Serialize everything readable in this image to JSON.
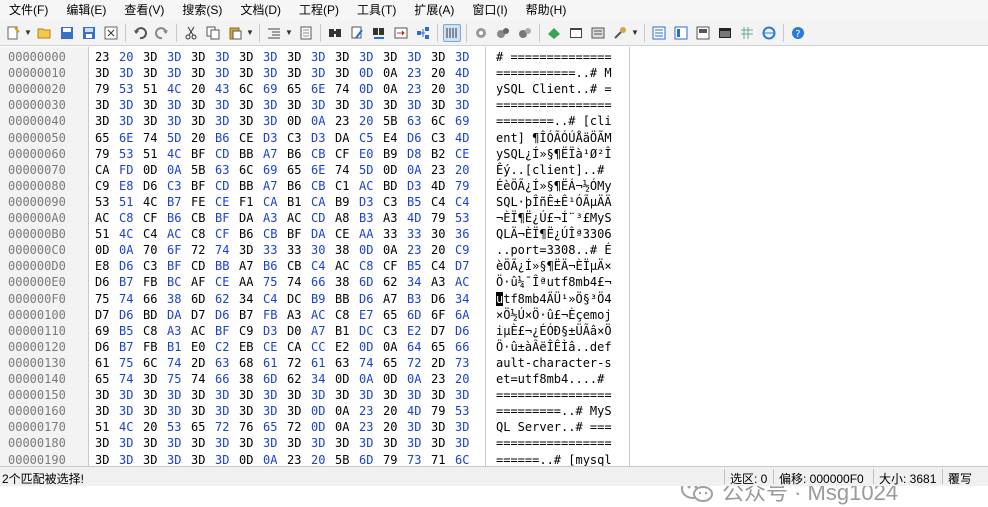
{
  "menu": [
    "文件(F)",
    "编辑(E)",
    "查看(V)",
    "搜索(S)",
    "文档(D)",
    "工程(P)",
    "工具(T)",
    "扩展(A)",
    "窗口(I)",
    "帮助(H)"
  ],
  "toolbar_icons": [
    "new-file-icon",
    "open-folder-icon",
    "save-icon",
    "save-all-icon",
    "close-file-icon",
    "undo-icon",
    "redo-icon",
    "cut-icon",
    "copy-icon",
    "paste-icon",
    "insert-icon",
    "document-icon",
    "find-icon",
    "find-next-icon",
    "find-in-files-icon",
    "goto-icon",
    "structure-icon",
    "hex-mode-icon",
    "settings-icon",
    "wrench-icon",
    "browser-icon",
    "help-icon"
  ],
  "rows": [
    {
      "addr": "00000000",
      "hex": [
        "23",
        "20",
        "3D",
        "3D",
        "3D",
        "3D",
        "3D",
        "3D",
        "3D",
        "3D",
        "3D",
        "3D",
        "3D",
        "3D",
        "3D",
        "3D"
      ],
      "ascii": "# =============="
    },
    {
      "addr": "00000010",
      "hex": [
        "3D",
        "3D",
        "3D",
        "3D",
        "3D",
        "3D",
        "3D",
        "3D",
        "3D",
        "3D",
        "3D",
        "0D",
        "0A",
        "23",
        "20",
        "4D"
      ],
      "ascii": "===========..# M"
    },
    {
      "addr": "00000020",
      "hex": [
        "79",
        "53",
        "51",
        "4C",
        "20",
        "43",
        "6C",
        "69",
        "65",
        "6E",
        "74",
        "0D",
        "0A",
        "23",
        "20",
        "3D"
      ],
      "ascii": "ySQL Client..# ="
    },
    {
      "addr": "00000030",
      "hex": [
        "3D",
        "3D",
        "3D",
        "3D",
        "3D",
        "3D",
        "3D",
        "3D",
        "3D",
        "3D",
        "3D",
        "3D",
        "3D",
        "3D",
        "3D",
        "3D"
      ],
      "ascii": "================"
    },
    {
      "addr": "00000040",
      "hex": [
        "3D",
        "3D",
        "3D",
        "3D",
        "3D",
        "3D",
        "3D",
        "3D",
        "0D",
        "0A",
        "23",
        "20",
        "5B",
        "63",
        "6C",
        "69"
      ],
      "ascii": "========..# [cli"
    },
    {
      "addr": "00000050",
      "hex": [
        "65",
        "6E",
        "74",
        "5D",
        "20",
        "B6",
        "CE",
        "D3",
        "C3",
        "D3",
        "DA",
        "C5",
        "E4",
        "D6",
        "C3",
        "4D"
      ],
      "ascii": "ent] ¶ÎÓÃÓÚÅäÖÃM"
    },
    {
      "addr": "00000060",
      "hex": [
        "79",
        "53",
        "51",
        "4C",
        "BF",
        "CD",
        "BB",
        "A7",
        "B6",
        "CB",
        "CF",
        "E0",
        "B9",
        "D8",
        "B2",
        "CE"
      ],
      "ascii": "ySQL¿Í»§¶ËÏà¹Ø²Î"
    },
    {
      "addr": "00000070",
      "hex": [
        "CA",
        "FD",
        "0D",
        "0A",
        "5B",
        "63",
        "6C",
        "69",
        "65",
        "6E",
        "74",
        "5D",
        "0D",
        "0A",
        "23",
        "20"
      ],
      "ascii": "Êý..[client]..# "
    },
    {
      "addr": "00000080",
      "hex": [
        "C9",
        "E8",
        "D6",
        "C3",
        "BF",
        "CD",
        "BB",
        "A7",
        "B6",
        "CB",
        "C1",
        "AC",
        "BD",
        "D3",
        "4D",
        "79"
      ],
      "ascii": "ÉèÖÃ¿Í»§¶ËÁ¬½ÓMy"
    },
    {
      "addr": "00000090",
      "hex": [
        "53",
        "51",
        "4C",
        "B7",
        "FE",
        "CE",
        "F1",
        "CA",
        "B1",
        "CA",
        "B9",
        "D3",
        "C3",
        "B5",
        "C4",
        "C4"
      ],
      "ascii": "SQL·þÎñÊ±Ê¹ÓÃµÄÄ"
    },
    {
      "addr": "000000A0",
      "hex": [
        "AC",
        "C8",
        "CF",
        "B6",
        "CB",
        "BF",
        "DA",
        "A3",
        "AC",
        "CD",
        "A8",
        "B3",
        "A3",
        "4D",
        "79",
        "53"
      ],
      "ascii": "¬ÈÏ¶Ë¿Ú£¬Í¨³£MyS"
    },
    {
      "addr": "000000B0",
      "hex": [
        "51",
        "4C",
        "C4",
        "AC",
        "C8",
        "CF",
        "B6",
        "CB",
        "BF",
        "DA",
        "CE",
        "AA",
        "33",
        "33",
        "30",
        "36"
      ],
      "ascii": "QLÄ¬ÈÏ¶Ë¿ÚÎª3306"
    },
    {
      "addr": "000000C0",
      "hex": [
        "0D",
        "0A",
        "70",
        "6F",
        "72",
        "74",
        "3D",
        "33",
        "33",
        "30",
        "38",
        "0D",
        "0A",
        "23",
        "20",
        "C9"
      ],
      "ascii": "..port=3308..# É"
    },
    {
      "addr": "000000D0",
      "hex": [
        "E8",
        "D6",
        "C3",
        "BF",
        "CD",
        "BB",
        "A7",
        "B6",
        "CB",
        "C4",
        "AC",
        "C8",
        "CF",
        "B5",
        "C4",
        "D7"
      ],
      "ascii": "èÖÃ¿Í»§¶ËÄ¬ÈÏµÄ×"
    },
    {
      "addr": "000000E0",
      "hex": [
        "D6",
        "B7",
        "FB",
        "BC",
        "AF",
        "CE",
        "AA",
        "75",
        "74",
        "66",
        "38",
        "6D",
        "62",
        "34",
        "A3",
        "AC"
      ],
      "ascii": "Ö·û¼¯Îªutf8mb4£¬"
    },
    {
      "addr": "000000F0",
      "hex": [
        "75",
        "74",
        "66",
        "38",
        "6D",
        "62",
        "34",
        "C4",
        "DC",
        "B9",
        "BB",
        "D6",
        "A7",
        "B3",
        "D6",
        "34"
      ],
      "ascii_pre": "",
      "ascii_cursor": "u",
      "ascii": "tf8mb4ÄÜ¹»Ö§³Ö4"
    },
    {
      "addr": "00000100",
      "hex": [
        "D7",
        "D6",
        "BD",
        "DA",
        "D7",
        "D6",
        "B7",
        "FB",
        "A3",
        "AC",
        "C8",
        "E7",
        "65",
        "6D",
        "6F",
        "6A"
      ],
      "ascii": "×Ö½Ú×Ö·û£¬Èçemoj"
    },
    {
      "addr": "00000110",
      "hex": [
        "69",
        "B5",
        "C8",
        "A3",
        "AC",
        "BF",
        "C9",
        "D3",
        "D0",
        "A7",
        "B1",
        "DC",
        "C3",
        "E2",
        "D7",
        "D6"
      ],
      "ascii": "iµÈ£¬¿ÉÓÐ§±ÜÃâ×Ö"
    },
    {
      "addr": "00000120",
      "hex": [
        "D6",
        "B7",
        "FB",
        "B1",
        "E0",
        "C2",
        "EB",
        "CE",
        "CA",
        "CC",
        "E2",
        "0D",
        "0A",
        "64",
        "65",
        "66"
      ],
      "ascii": "Ö·û±àÂëÎÊÌâ..def"
    },
    {
      "addr": "00000130",
      "hex": [
        "61",
        "75",
        "6C",
        "74",
        "2D",
        "63",
        "68",
        "61",
        "72",
        "61",
        "63",
        "74",
        "65",
        "72",
        "2D",
        "73"
      ],
      "ascii": "ault-character-s"
    },
    {
      "addr": "00000140",
      "hex": [
        "65",
        "74",
        "3D",
        "75",
        "74",
        "66",
        "38",
        "6D",
        "62",
        "34",
        "0D",
        "0A",
        "0D",
        "0A",
        "23",
        "20"
      ],
      "ascii": "et=utf8mb4....# "
    },
    {
      "addr": "00000150",
      "hex": [
        "3D",
        "3D",
        "3D",
        "3D",
        "3D",
        "3D",
        "3D",
        "3D",
        "3D",
        "3D",
        "3D",
        "3D",
        "3D",
        "3D",
        "3D",
        "3D"
      ],
      "ascii": "================"
    },
    {
      "addr": "00000160",
      "hex": [
        "3D",
        "3D",
        "3D",
        "3D",
        "3D",
        "3D",
        "3D",
        "3D",
        "3D",
        "0D",
        "0A",
        "23",
        "20",
        "4D",
        "79",
        "53"
      ],
      "ascii": "=========..# MyS"
    },
    {
      "addr": "00000170",
      "hex": [
        "51",
        "4C",
        "20",
        "53",
        "65",
        "72",
        "76",
        "65",
        "72",
        "0D",
        "0A",
        "23",
        "20",
        "3D",
        "3D",
        "3D"
      ],
      "ascii": "QL Server..# ==="
    },
    {
      "addr": "00000180",
      "hex": [
        "3D",
        "3D",
        "3D",
        "3D",
        "3D",
        "3D",
        "3D",
        "3D",
        "3D",
        "3D",
        "3D",
        "3D",
        "3D",
        "3D",
        "3D",
        "3D"
      ],
      "ascii": "================"
    },
    {
      "addr": "00000190",
      "hex": [
        "3D",
        "3D",
        "3D",
        "3D",
        "3D",
        "3D",
        "0D",
        "0A",
        "23",
        "20",
        "5B",
        "6D",
        "79",
        "73",
        "71",
        "6C"
      ],
      "ascii": "======..# [mysql"
    }
  ],
  "watermark": "公众号 · Msg1024",
  "status": {
    "message": "2个匹配被选择!",
    "selection": "选区: 0",
    "offset": "偏移: 000000F0",
    "size": "大小: 3681",
    "mode": "覆写"
  },
  "colors": {
    "hex_dark": "#000000",
    "hex_blue": "#1c3fd0",
    "address": "#7a7a7a"
  }
}
